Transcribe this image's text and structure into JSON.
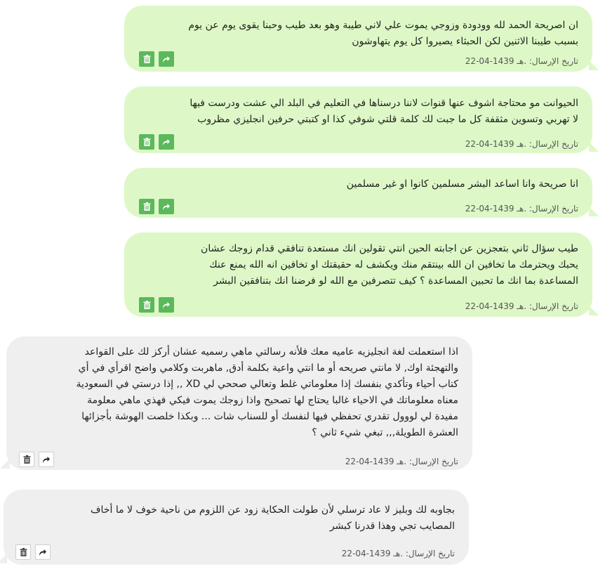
{
  "messages": [
    {
      "side": "sent",
      "lines": [
        "ان اصريحة الحمد لله وودودة وزوجي يموت علي لاني طيبة وهو بعد طيب وحبنا يقوى يوم عن يوم",
        "بسبب طيبنا الاثنين لكن الحبثاء يصيروا كل يوم يتهاوشون"
      ],
      "date_label": "تاريخ الإرسال:",
      "date_value": "22-04-1439 هـ."
    },
    {
      "side": "sent",
      "lines": [
        "الحيوانت مو محتاجة اشوف عنها قنوات لاننا درسناها في التعليم في البلد الي عشت ودرست فيها",
        "لا تهربي وتسوين مثقفة كل ما جبت لك كلمة قلتي شوفي كذا او كتبتي حرفين انجليزي مظروب"
      ],
      "date_label": "تاريخ الإرسال:",
      "date_value": "22-04-1439 هـ."
    },
    {
      "side": "sent",
      "lines": [
        "انا صريحة وانا اساعد البشر مسلمين كانوا او غير مسلمين"
      ],
      "date_label": "تاريخ الإرسال:",
      "date_value": "22-04-1439 هـ."
    },
    {
      "side": "sent",
      "lines": [
        "طيب سؤال ثاني بتعجزين عن اجابته الحين انتي تقولين انك مستعدة تنافقي قدام زوجك عشان",
        "يحبك ويحترمك ما تخافين ان الله بينتقم منك ويكشف له حقيقتك او تخافين انه الله يمنع عنك",
        "المساعدة بما انك ما تحبين المساعدة ؟ كيف تتصرفين مع الله لو فرضنا انك بتنافقين البشر"
      ],
      "date_label": "تاريخ الإرسال:",
      "date_value": "22-04-1439 هـ."
    },
    {
      "side": "received",
      "lines": [
        "اذا استعملت لغة انجليزيه عاميه معك فلأنه رسالتي ماهي رسميه عشان أركز لك على القواعد",
        "والتهجئة اوك, لا مانتي صريحه أو ما انتي واعية بكلمة أدق, ماهربت وكلامي واضح اقرأي في أي",
        "كتاب أحياء وتأكدي بنفسك إذا معلوماتي غلط وتعالي صححي لي XD ,, إذا درستي في السعودية",
        "معناه معلوماتك في الاحياء غالبا يحتاج لها تصحيح واذا زوجك يموت فيكي فهذي ماهي معلومة",
        "مفيدة لي لووول تقدري تحفظي فيها لنفسك أو للسناب شات ... وبكذا خلصت الهوشة بأجزائها",
        "العشرة الطويلة,,, تبغي شيء ثاني ؟"
      ],
      "date_label": "تاريخ الإرسال:",
      "date_value": "22-04-1439 هـ."
    },
    {
      "side": "received",
      "lines": [
        "بجاوبه لك وبليز لا عاد ترسلي لأن طولت الحكاية زود عن اللزوم من ناحية خوف لا ما أخاف",
        "المصايب تجي وهذا قدرنا كبشر"
      ],
      "date_label": "تاريخ الإرسال:",
      "date_value": "22-04-1439 هـ."
    }
  ],
  "icons": {
    "delete": "trash-icon",
    "forward": "forward-arrow-icon"
  },
  "colors": {
    "sent_bubble": "#ddf8c6",
    "received_bubble": "#efefef",
    "action_green": "#5cb85c"
  }
}
